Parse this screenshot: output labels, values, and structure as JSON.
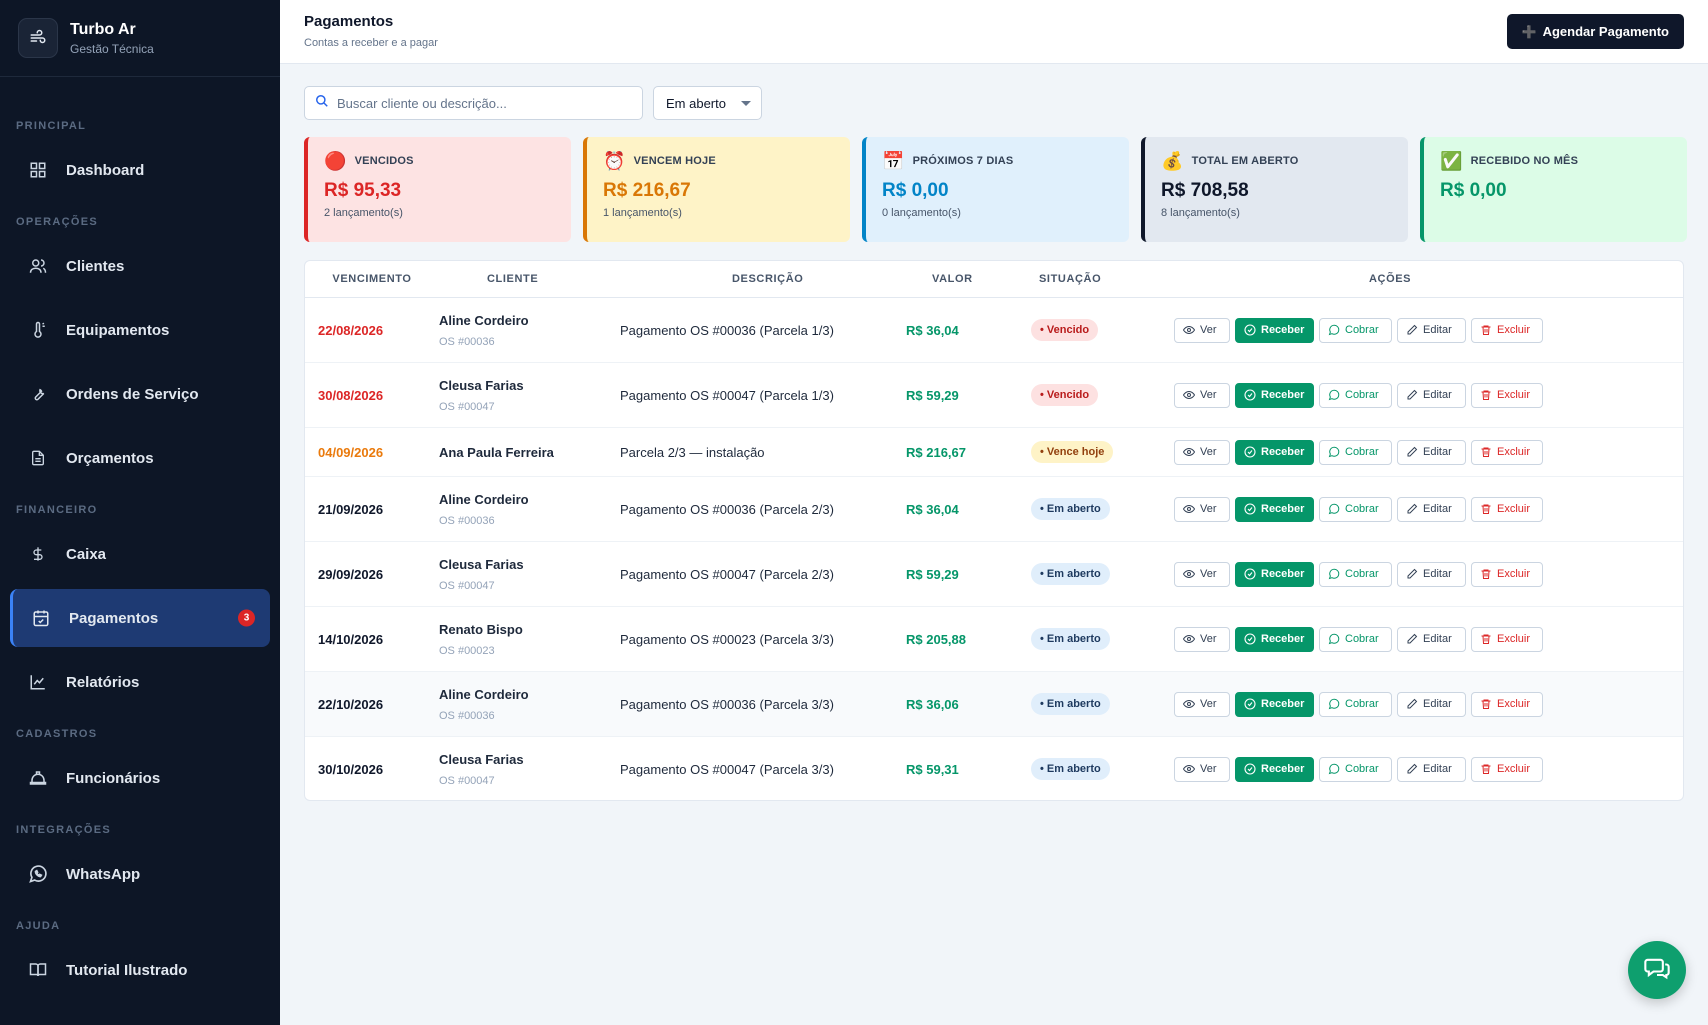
{
  "brand": {
    "name": "Turbo Ar",
    "subtitle": "Gestão Técnica",
    "icon": "wind-icon"
  },
  "sidebar": {
    "sections": [
      {
        "title": "PRINCIPAL",
        "items": [
          {
            "label": "Dashboard",
            "icon": "grid-icon"
          }
        ]
      },
      {
        "title": "OPERAÇÕES",
        "items": [
          {
            "label": "Clientes",
            "icon": "users-icon"
          },
          {
            "label": "Equipamentos",
            "icon": "thermometer-icon"
          },
          {
            "label": "Ordens de Serviço",
            "icon": "wrench-icon"
          },
          {
            "label": "Orçamentos",
            "icon": "document-icon"
          }
        ]
      },
      {
        "title": "FINANCEIRO",
        "items": [
          {
            "label": "Caixa",
            "icon": "dollar-icon"
          },
          {
            "label": "Pagamentos",
            "icon": "calendar-check-icon",
            "active": true,
            "badge": "3"
          },
          {
            "label": "Relatórios",
            "icon": "chart-line-icon"
          }
        ]
      },
      {
        "title": "CADASTROS",
        "items": [
          {
            "label": "Funcionários",
            "icon": "hardhat-icon"
          }
        ]
      },
      {
        "title": "INTEGRAÇÕES",
        "items": [
          {
            "label": "WhatsApp",
            "icon": "whatsapp-icon"
          }
        ]
      },
      {
        "title": "AJUDA",
        "items": [
          {
            "label": "Tutorial Ilustrado",
            "icon": "book-icon"
          }
        ]
      }
    ]
  },
  "header": {
    "title": "Pagamentos",
    "subtitle": "Contas a receber e a pagar",
    "primary_button": "Agendar Pagamento",
    "primary_icon": "➕"
  },
  "filters": {
    "search_placeholder": "Buscar cliente ou descrição...",
    "status_value": "Em aberto"
  },
  "summary_cards": [
    {
      "icon": "🔴",
      "label": "VENCIDOS",
      "value": "R$ 95,33",
      "count": "2 lançamento(s)",
      "tone": "red"
    },
    {
      "icon": "⏰",
      "label": "VENCEM HOJE",
      "value": "R$ 216,67",
      "count": "1 lançamento(s)",
      "tone": "amber"
    },
    {
      "icon": "📅",
      "label": "PRÓXIMOS 7 DIAS",
      "value": "R$ 0,00",
      "count": "0 lançamento(s)",
      "tone": "blue"
    },
    {
      "icon": "💰",
      "label": "TOTAL EM ABERTO",
      "value": "R$ 708,58",
      "count": "8 lançamento(s)",
      "tone": "slate"
    },
    {
      "icon": "✅",
      "label": "RECEBIDO NO MÊS",
      "value": "R$ 0,00",
      "count": "",
      "tone": "green"
    }
  ],
  "table": {
    "headers": {
      "vencimento": "VENCIMENTO",
      "cliente": "CLIENTE",
      "descricao": "DESCRIÇÃO",
      "valor": "VALOR",
      "situacao": "SITUAÇÃO",
      "acoes": "AÇÕES"
    },
    "actions": {
      "ver": "Ver",
      "receber": "Receber",
      "cobrar": "Cobrar",
      "editar": "Editar",
      "excluir": "Excluir"
    },
    "rows": [
      {
        "date": "22/08/2026",
        "date_tone": "red",
        "client": "Aline Cordeiro",
        "os": "OS #00036",
        "desc": "Pagamento OS #00036 (Parcela 1/3)",
        "value": "R$ 36,04",
        "status": "• Vencido",
        "status_tone": "red"
      },
      {
        "date": "30/08/2026",
        "date_tone": "red",
        "client": "Cleusa Farias",
        "os": "OS #00047",
        "desc": "Pagamento OS #00047 (Parcela 1/3)",
        "value": "R$ 59,29",
        "status": "• Vencido",
        "status_tone": "red"
      },
      {
        "date": "04/09/2026",
        "date_tone": "orange",
        "client": "Ana Paula Ferreira",
        "os": "",
        "desc": "Parcela 2/3 — instalação",
        "value": "R$ 216,67",
        "status": "• Vence hoje",
        "status_tone": "amber"
      },
      {
        "date": "21/09/2026",
        "date_tone": "dark",
        "client": "Aline Cordeiro",
        "os": "OS #00036",
        "desc": "Pagamento OS #00036 (Parcela 2/3)",
        "value": "R$ 36,04",
        "status": "• Em aberto",
        "status_tone": "blue"
      },
      {
        "date": "29/09/2026",
        "date_tone": "dark",
        "client": "Cleusa Farias",
        "os": "OS #00047",
        "desc": "Pagamento OS #00047 (Parcela 2/3)",
        "value": "R$ 59,29",
        "status": "• Em aberto",
        "status_tone": "blue"
      },
      {
        "date": "14/10/2026",
        "date_tone": "dark",
        "client": "Renato Bispo",
        "os": "OS #00023",
        "desc": "Pagamento OS #00023 (Parcela 3/3)",
        "value": "R$ 205,88",
        "status": "• Em aberto",
        "status_tone": "blue"
      },
      {
        "date": "22/10/2026",
        "date_tone": "dark",
        "client": "Aline Cordeiro",
        "os": "OS #00036",
        "desc": "Pagamento OS #00036 (Parcela 3/3)",
        "value": "R$ 36,06",
        "status": "• Em aberto",
        "status_tone": "blue"
      },
      {
        "date": "30/10/2026",
        "date_tone": "dark",
        "client": "Cleusa Farias",
        "os": "OS #00047",
        "desc": "Pagamento OS #00047 (Parcela 3/3)",
        "value": "R$ 59,31",
        "status": "• Em aberto",
        "status_tone": "blue"
      }
    ]
  },
  "fab": {
    "icon": "chat-icon"
  },
  "colors": {
    "sidebar_bg": "#0d1626",
    "active_item": "#1e3a73",
    "accent_green": "#059669",
    "danger": "#dc2626",
    "warning": "#d97706",
    "info": "#0284c7"
  }
}
